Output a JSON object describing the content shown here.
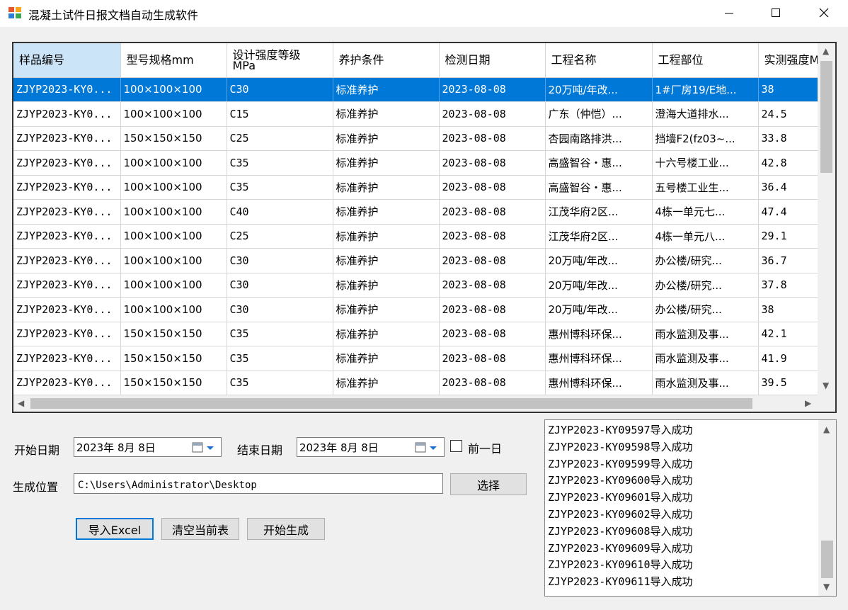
{
  "window": {
    "title": "混凝土试件日报文档自动生成软件",
    "minimize_icon": "minimize-icon",
    "maximize_icon": "maximize-icon",
    "close_icon": "close-icon"
  },
  "grid": {
    "columns": [
      "样品编号",
      "型号规格mm",
      "设计强度等级MPa",
      "养护条件",
      "检测日期",
      "工程名称",
      "工程部位",
      "实测强度MPa"
    ],
    "rows": [
      [
        "ZJYP2023-KY0...",
        "100×100×100",
        "C30",
        "标准养护",
        "2023-08-08",
        "20万吨/年改...",
        "1#厂房19/E地...",
        "38"
      ],
      [
        "ZJYP2023-KY0...",
        "100×100×100",
        "C15",
        "标准养护",
        "2023-08-08",
        "广东（仲恺）...",
        "澄海大道排水...",
        "24.5"
      ],
      [
        "ZJYP2023-KY0...",
        "150×150×150",
        "C25",
        "标准养护",
        "2023-08-08",
        "杏园南路排洪...",
        "挡墙F2(fz03~...",
        "33.8"
      ],
      [
        "ZJYP2023-KY0...",
        "100×100×100",
        "C35",
        "标准养护",
        "2023-08-08",
        "高盛智谷・惠...",
        "十六号楼工业...",
        "42.8"
      ],
      [
        "ZJYP2023-KY0...",
        "100×100×100",
        "C35",
        "标准养护",
        "2023-08-08",
        "高盛智谷・惠...",
        "五号楼工业生...",
        "36.4"
      ],
      [
        "ZJYP2023-KY0...",
        "100×100×100",
        "C40",
        "标准养护",
        "2023-08-08",
        "江茂华府2区...",
        "4栋一单元七...",
        "47.4"
      ],
      [
        "ZJYP2023-KY0...",
        "100×100×100",
        "C25",
        "标准养护",
        "2023-08-08",
        "江茂华府2区...",
        "4栋一单元八...",
        "29.1"
      ],
      [
        "ZJYP2023-KY0...",
        "100×100×100",
        "C30",
        "标准养护",
        "2023-08-08",
        "20万吨/年改...",
        "办公楼/研究...",
        "36.7"
      ],
      [
        "ZJYP2023-KY0...",
        "100×100×100",
        "C30",
        "标准养护",
        "2023-08-08",
        "20万吨/年改...",
        "办公楼/研究...",
        "37.8"
      ],
      [
        "ZJYP2023-KY0...",
        "100×100×100",
        "C30",
        "标准养护",
        "2023-08-08",
        "20万吨/年改...",
        "办公楼/研究...",
        "38"
      ],
      [
        "ZJYP2023-KY0...",
        "150×150×150",
        "C35",
        "标准养护",
        "2023-08-08",
        "惠州博科环保...",
        "雨水监测及事...",
        "42.1"
      ],
      [
        "ZJYP2023-KY0...",
        "150×150×150",
        "C35",
        "标准养护",
        "2023-08-08",
        "惠州博科环保...",
        "雨水监测及事...",
        "41.9"
      ],
      [
        "ZJYP2023-KY0...",
        "150×150×150",
        "C35",
        "标准养护",
        "2023-08-08",
        "惠州博科环保...",
        "雨水监测及事...",
        "39.5"
      ]
    ]
  },
  "form": {
    "start_date_label": "开始日期",
    "start_date_value": "2023年 8月 8日",
    "end_date_label": "结束日期",
    "end_date_value": "2023年 8月 8日",
    "prev_day_label": "前一日",
    "output_label": "生成位置",
    "output_path": "C:\\Users\\Administrator\\Desktop",
    "choose_button": "选择",
    "import_button": "导入Excel",
    "clear_button": "清空当前表",
    "generate_button": "开始生成"
  },
  "log": {
    "lines": [
      "ZJYP2023-KY09597导入成功",
      "ZJYP2023-KY09598导入成功",
      "ZJYP2023-KY09599导入成功",
      "ZJYP2023-KY09600导入成功",
      "ZJYP2023-KY09601导入成功",
      "ZJYP2023-KY09602导入成功",
      "ZJYP2023-KY09608导入成功",
      "ZJYP2023-KY09609导入成功",
      "ZJYP2023-KY09610导入成功",
      "ZJYP2023-KY09611导入成功"
    ]
  },
  "colors": {
    "selection": "#0078d7",
    "sorted_header": "#cce4f7",
    "window_bg": "#f0f0f0"
  }
}
